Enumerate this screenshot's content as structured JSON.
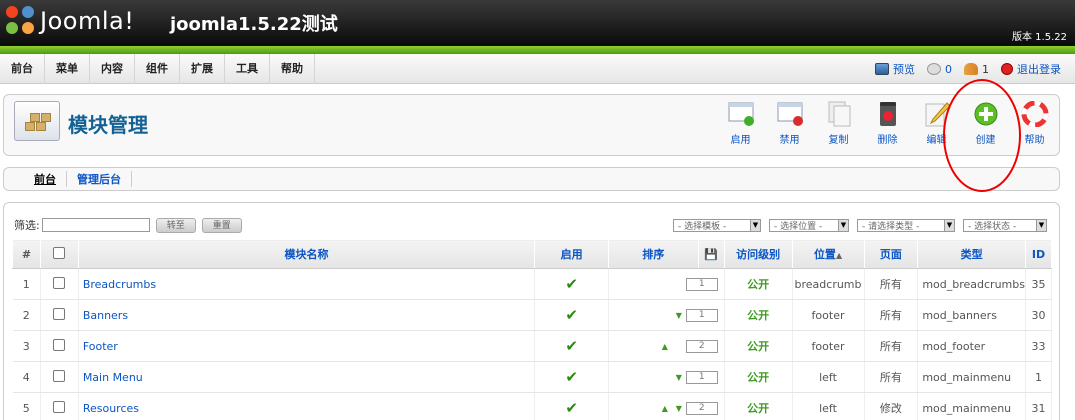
{
  "header": {
    "logo_text": "Joomla!",
    "site_title": "joomla1.5.22测试",
    "version": "版本 1.5.22"
  },
  "menu": [
    "前台",
    "菜单",
    "内容",
    "组件",
    "扩展",
    "工具",
    "帮助"
  ],
  "status": {
    "preview": "预览",
    "messages": "0",
    "users": "1",
    "logout": "退出登录"
  },
  "page_title": "模块管理",
  "toolbar": [
    {
      "label": "启用",
      "icon": "enable-icon"
    },
    {
      "label": "禁用",
      "icon": "disable-icon"
    },
    {
      "label": "复制",
      "icon": "copy-icon"
    },
    {
      "label": "删除",
      "icon": "delete-icon"
    },
    {
      "label": "编辑",
      "icon": "edit-icon"
    },
    {
      "label": "创建",
      "icon": "new-icon"
    },
    {
      "label": "帮助",
      "icon": "help-icon"
    }
  ],
  "subnav": {
    "site": "前台",
    "admin": "管理后台"
  },
  "filter": {
    "label": "筛选:",
    "go": "转至",
    "reset": "重置"
  },
  "selects": [
    "- 选择模板 -",
    "- 选择位置 -",
    "- 请选择类型 -",
    "- 选择状态 -"
  ],
  "columns": {
    "num": "#",
    "name": "模块名称",
    "enabled": "启用",
    "order": "排序",
    "access": "访问级别",
    "position": "位置",
    "pages": "页面",
    "type": "类型",
    "id": "ID"
  },
  "rows": [
    {
      "num": "1",
      "name": "Breadcrumbs",
      "order": "1",
      "up": false,
      "down": false,
      "access": "公开",
      "position": "breadcrumb",
      "pages": "所有",
      "type": "mod_breadcrumbs",
      "id": "35"
    },
    {
      "num": "2",
      "name": "Banners",
      "order": "1",
      "up": false,
      "down": true,
      "access": "公开",
      "position": "footer",
      "pages": "所有",
      "type": "mod_banners",
      "id": "30"
    },
    {
      "num": "3",
      "name": "Footer",
      "order": "2",
      "up": true,
      "down": false,
      "access": "公开",
      "position": "footer",
      "pages": "所有",
      "type": "mod_footer",
      "id": "33"
    },
    {
      "num": "4",
      "name": "Main Menu",
      "order": "1",
      "up": false,
      "down": true,
      "access": "公开",
      "position": "left",
      "pages": "所有",
      "type": "mod_mainmenu",
      "id": "1"
    },
    {
      "num": "5",
      "name": "Resources",
      "order": "2",
      "up": true,
      "down": true,
      "access": "公开",
      "position": "left",
      "pages": "修改",
      "type": "mod_mainmenu",
      "id": "31"
    }
  ]
}
